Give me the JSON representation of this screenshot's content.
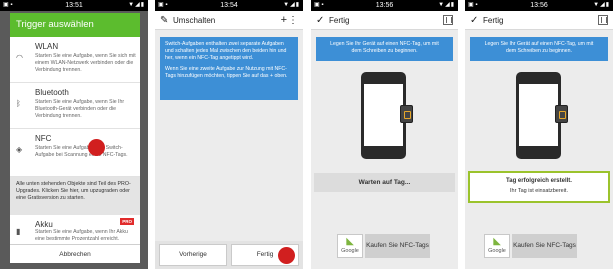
{
  "panel1": {
    "status_time": "13:51",
    "dialog_title": "Trigger auswählen",
    "items": [
      {
        "title": "WLAN",
        "desc": "Starten Sie eine Aufgabe, wenn Sie sich mit einem WLAN-Netzwerk verbinden oder die Verbindung trennen.",
        "icon": "wifi-icon"
      },
      {
        "title": "Bluetooth",
        "desc": "Starten Sie eine Aufgabe, wenn Sie Ihr Bluetooth-Gerät verbinden oder die Verbindung trennen.",
        "icon": "bluetooth-icon"
      },
      {
        "title": "NFC",
        "desc": "Starten Sie eine Aufgabe oder Switch-Aufgabe bei Scannung eines NFC-Tags.",
        "icon": "nfc-icon"
      }
    ],
    "pro_note": "Alle unten stehenden Objekte sind Teil des PRO-Upgrades. Klicken Sie hier, um upzugraden oder eine Gratisversion zu starten.",
    "akku": {
      "title": "Akku",
      "desc": "Starten Sie eine Aufgabe, wenn Ihr Akku eine bestimmte Prozentzahl erreicht.",
      "badge": "PRO"
    },
    "cancel_label": "Abbrechen"
  },
  "panel2": {
    "status_time": "13:54",
    "title": "Umschalten",
    "info_p1": "Switch-Aufgaben enthalten zwei separate Aufgaben und schalten jedes Mal zwischen den beiden hin und her, wenn ein NFC-Tag angetippt wird.",
    "info_p2": "Wenn Sie eine zweite Aufgabe zur Nutzung mit NFC-Tags hinzufügen möchten, tippen Sie auf das + oben.",
    "prev_label": "Vorherige",
    "done_label": "Fertig"
  },
  "panel3": {
    "status_time": "13:56",
    "title": "Fertig",
    "message": "Legen Sie Ihr Gerät auf einen NFC-Tag, um mit dem Schreiben zu beginnen.",
    "waiting": "Warten auf Tag...",
    "google_label": "Google",
    "buy_label": "Kaufen Sie NFC-Tags"
  },
  "panel4": {
    "status_time": "13:56",
    "title": "Fertig",
    "message": "Legen Sie Ihr Gerät auf einen NFC-Tag, um mit dem Schreiben zu beginnen.",
    "success_title": "Tag erfolgreich erstellt.",
    "success_sub": "Ihr Tag ist einsatzbereit.",
    "google_label": "Google",
    "buy_label": "Kaufen Sie NFC-Tags"
  },
  "colors": {
    "green": "#5cbc2e",
    "blue": "#3d8fd6",
    "red": "#d11f1f",
    "success_border": "#9bc32c"
  }
}
